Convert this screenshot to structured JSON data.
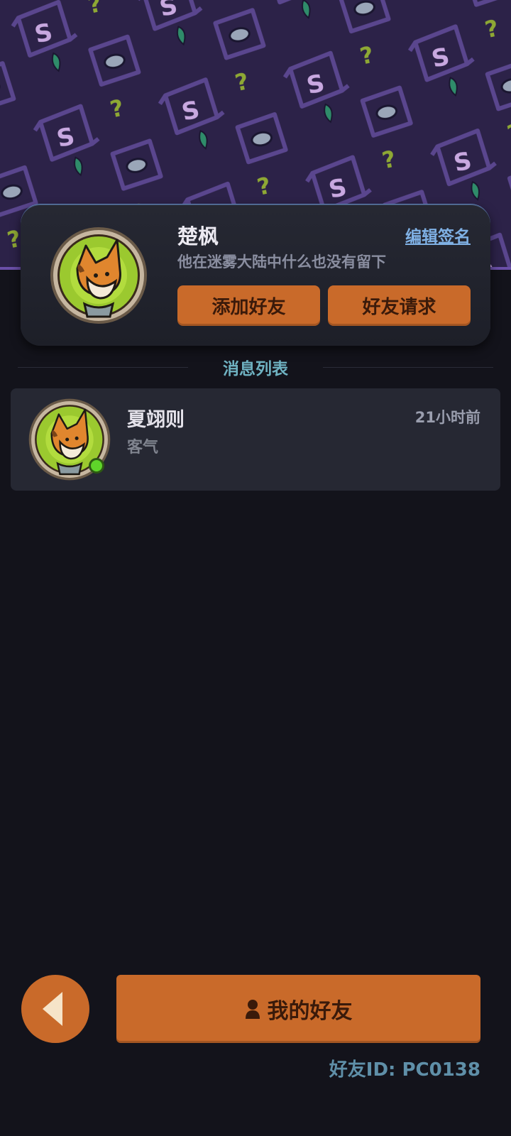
{
  "profile": {
    "name": "楚枫",
    "edit_sign_label": "编辑签名",
    "signature": "他在迷雾大陆中什么也没有留下",
    "add_friend_label": "添加好友",
    "friend_request_label": "好友请求"
  },
  "messages": {
    "section_title": "消息列表",
    "items": [
      {
        "name": "夏翊则",
        "time": "21小时前",
        "preview": "客气",
        "online": true
      }
    ]
  },
  "bottom": {
    "my_friends_label": "我的好友",
    "friend_id": "好友ID: PC0138"
  },
  "colors": {
    "accent_orange": "#c96a2a",
    "link_blue": "#7fb0e4",
    "section_teal": "#6fb2c2",
    "online_green": "#5fd42a",
    "banner_purple": "#2c2248"
  },
  "icons": {
    "back": "chevron-left-icon",
    "friends": "person-icon",
    "online": "online-status-icon"
  }
}
